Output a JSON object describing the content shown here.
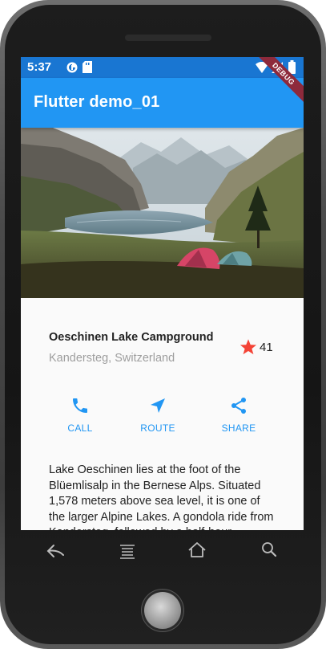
{
  "status_bar": {
    "time": "5:37",
    "color": "#1976d2"
  },
  "app_bar": {
    "title": "Flutter demo_01",
    "color": "#2196f3",
    "debug_banner": "DEBUG"
  },
  "place": {
    "name": "Oeschinen Lake Campground",
    "location": "Kandersteg, Switzerland",
    "favorite_count": "41",
    "star_color": "#f44336"
  },
  "actions": [
    {
      "label": "CALL",
      "icon": "phone-icon"
    },
    {
      "label": "ROUTE",
      "icon": "navigation-icon"
    },
    {
      "label": "SHARE",
      "icon": "share-icon"
    }
  ],
  "description": "Lake Oeschinen lies at the foot of the Blüemlisalp in the Bernese Alps. Situated 1,578 meters above sea level, it is one of the larger Alpine Lakes. A gondola ride from Kandersteg, followed by a half-hour",
  "nav_bar": {
    "back_icon": "back-arrow-icon",
    "menu_icon": "menu-icon",
    "home_icon": "home-icon",
    "search_icon": "search-icon"
  }
}
